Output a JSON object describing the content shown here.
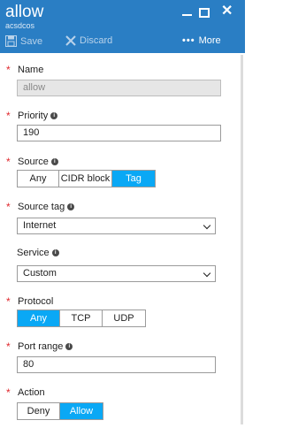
{
  "header": {
    "title": "allow",
    "subtitle": "acsdcos",
    "save_label": "Save",
    "discard_label": "Discard",
    "more_label": "More",
    "more_dots": "•••",
    "close_glyph": "✕"
  },
  "required_mark": "*",
  "info_glyph": "i",
  "form": {
    "name": {
      "label": "Name",
      "value": "allow"
    },
    "priority": {
      "label": "Priority",
      "value": "190"
    },
    "source": {
      "label": "Source",
      "options": [
        "Any",
        "CIDR block",
        "Tag"
      ],
      "selected": "Tag"
    },
    "source_tag": {
      "label": "Source tag",
      "value": "Internet"
    },
    "service": {
      "label": "Service",
      "value": "Custom"
    },
    "protocol": {
      "label": "Protocol",
      "options": [
        "Any",
        "TCP",
        "UDP"
      ],
      "selected": "Any"
    },
    "port_range": {
      "label": "Port range",
      "value": "80"
    },
    "action": {
      "label": "Action",
      "options": [
        "Deny",
        "Allow"
      ],
      "selected": "Allow"
    }
  },
  "colors": {
    "header": "#2a7ec4",
    "accent": "#0aa8f5",
    "required": "#e0292e"
  }
}
